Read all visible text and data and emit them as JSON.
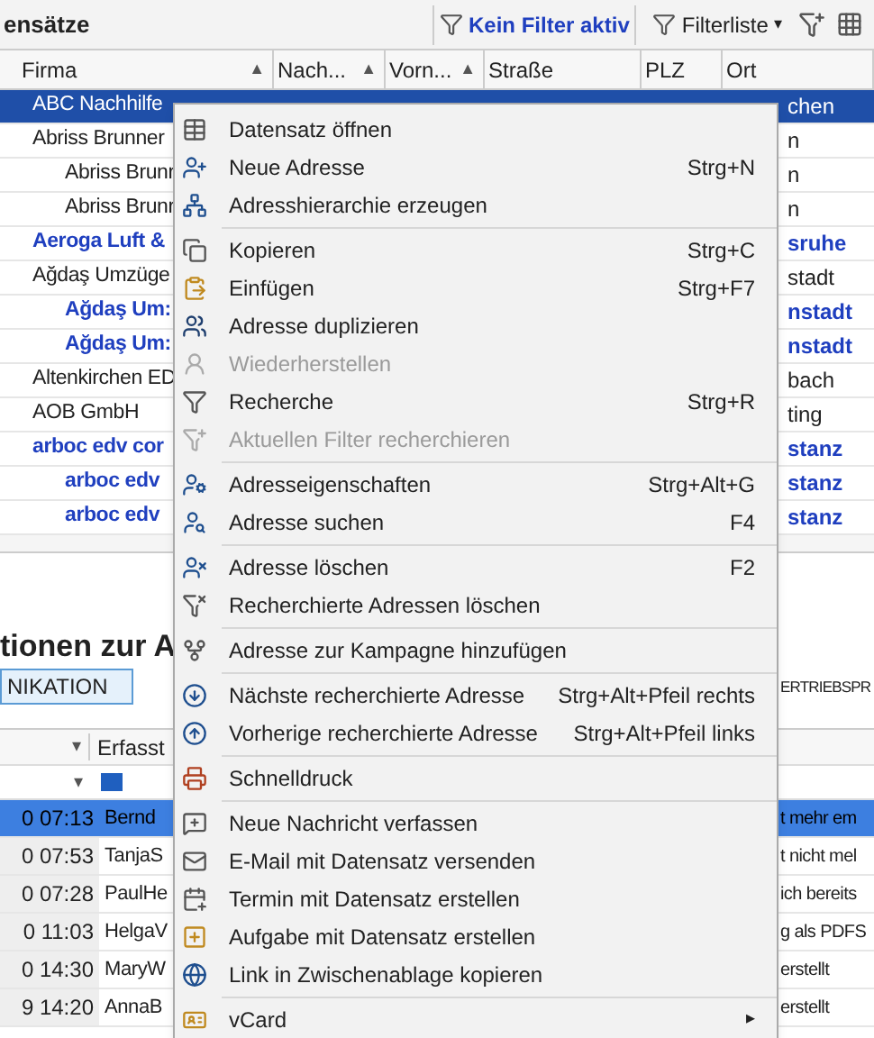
{
  "toolbar": {
    "title": "ensätze",
    "filter_status": "Kein Filter aktiv",
    "filter_list": "Filterliste",
    "filter_list_caret": "▾"
  },
  "grid": {
    "columns": [
      {
        "label": "Firma",
        "sort": "▲"
      },
      {
        "label": "Nach...",
        "sort": "▲"
      },
      {
        "label": "Vorn...",
        "sort": "▲"
      },
      {
        "label": "Straße"
      },
      {
        "label": "PLZ"
      },
      {
        "label": "Ort"
      }
    ],
    "rows": [
      {
        "firma": "ABC Nachhilfe",
        "ort": "chen",
        "selected": true,
        "kind": "plain"
      },
      {
        "firma": "Abriss Brunner",
        "ort": "n",
        "selected": false,
        "kind": "plain"
      },
      {
        "firma": "Abriss Brunr",
        "ort": "n",
        "selected": false,
        "kind": "child"
      },
      {
        "firma": "Abriss Brunr",
        "ort": "n",
        "selected": false,
        "kind": "child"
      },
      {
        "firma": "Aeroga Luft &",
        "ort": "sruhe",
        "selected": false,
        "kind": "parent"
      },
      {
        "firma": "Ağdaş Umzüge",
        "ort": "stadt",
        "selected": false,
        "kind": "plain"
      },
      {
        "firma": "Ağdaş Um:",
        "ort": "nstadt",
        "selected": false,
        "kind": "child-bold"
      },
      {
        "firma": "Ağdaş Um:",
        "ort": "nstadt",
        "selected": false,
        "kind": "child-bold"
      },
      {
        "firma": "Altenkirchen ED",
        "ort": "bach",
        "selected": false,
        "kind": "plain"
      },
      {
        "firma": "AOB GmbH",
        "ort": "ting",
        "selected": false,
        "kind": "plain"
      },
      {
        "firma": "arboc edv cor",
        "ort": "stanz",
        "selected": false,
        "kind": "parent"
      },
      {
        "firma": "arboc edv",
        "ort": "stanz",
        "selected": false,
        "kind": "child-bold"
      },
      {
        "firma": "arboc edv",
        "ort": "stanz",
        "selected": false,
        "kind": "child-bold"
      }
    ]
  },
  "section": {
    "heading": "tionen zur A",
    "tab_button": "NIKATION",
    "right_label": "ERTRIEBSPR"
  },
  "lower_grid": {
    "header_sort": "▾",
    "header_label": "Erfasst",
    "filter_caret": "▾",
    "rows": [
      {
        "time": "0 07:13",
        "name": "Bernd",
        "text": "t mehr em",
        "selected": true
      },
      {
        "time": "0 07:53",
        "name": "TanjaS",
        "text": "t nicht mel",
        "selected": false
      },
      {
        "time": "0 07:28",
        "name": "PaulHe",
        "text": "ich bereits",
        "selected": false
      },
      {
        "time": "0 11:03",
        "name": "HelgaV",
        "text": "g als PDFS",
        "selected": false
      },
      {
        "time": "0 14:30",
        "name": "MaryW",
        "text": "erstellt",
        "selected": false
      },
      {
        "time": "9 14:20",
        "name": "AnnaB",
        "text": "erstellt",
        "selected": false
      }
    ]
  },
  "context_menu": [
    {
      "kind": "item",
      "label": "Datensatz öffnen",
      "disabled": false
    },
    {
      "kind": "item",
      "label": "Neue Adresse",
      "shortcut": "Strg+N",
      "disabled": false
    },
    {
      "kind": "item",
      "label": "Adresshierarchie erzeugen",
      "disabled": false
    },
    {
      "kind": "separator"
    },
    {
      "kind": "item",
      "label": "Kopieren",
      "shortcut": "Strg+C",
      "disabled": false
    },
    {
      "kind": "item",
      "label": "Einfügen",
      "shortcut": "Strg+F7",
      "disabled": false
    },
    {
      "kind": "item",
      "label": "Adresse duplizieren",
      "disabled": false
    },
    {
      "kind": "item",
      "label": "Wiederherstellen",
      "disabled": true
    },
    {
      "kind": "item",
      "label": "Recherche",
      "shortcut": "Strg+R",
      "disabled": false
    },
    {
      "kind": "item",
      "label": "Aktuellen Filter recherchieren",
      "disabled": true
    },
    {
      "kind": "separator"
    },
    {
      "kind": "item",
      "label": "Adresseigenschaften",
      "shortcut": "Strg+Alt+G",
      "disabled": false
    },
    {
      "kind": "item",
      "label": "Adresse suchen",
      "shortcut": "F4",
      "disabled": false
    },
    {
      "kind": "separator"
    },
    {
      "kind": "item",
      "label": "Adresse löschen",
      "shortcut": "F2",
      "disabled": false
    },
    {
      "kind": "item",
      "label": "Recherchierte Adressen löschen",
      "disabled": false
    },
    {
      "kind": "separator"
    },
    {
      "kind": "item",
      "label": "Adresse zur Kampagne hinzufügen",
      "disabled": false
    },
    {
      "kind": "separator"
    },
    {
      "kind": "item",
      "label": "Nächste recherchierte Adresse",
      "shortcut": "Strg+Alt+Pfeil rechts",
      "disabled": false
    },
    {
      "kind": "item",
      "label": "Vorherige recherchierte Adresse",
      "shortcut": "Strg+Alt+Pfeil links",
      "disabled": false
    },
    {
      "kind": "separator"
    },
    {
      "kind": "item",
      "label": "Schnelldruck",
      "disabled": false
    },
    {
      "kind": "separator"
    },
    {
      "kind": "item",
      "label": "Neue Nachricht verfassen",
      "disabled": false
    },
    {
      "kind": "item",
      "label": "E-Mail mit Datensatz versenden",
      "disabled": false
    },
    {
      "kind": "item",
      "label": "Termin mit Datensatz erstellen",
      "disabled": false
    },
    {
      "kind": "item",
      "label": "Aufgabe mit Datensatz erstellen",
      "disabled": false
    },
    {
      "kind": "item",
      "label": "Link in Zwischenablage kopieren",
      "disabled": false
    },
    {
      "kind": "separator"
    },
    {
      "kind": "submenu",
      "label": "vCard",
      "arrow": "▸",
      "disabled": false
    }
  ]
}
